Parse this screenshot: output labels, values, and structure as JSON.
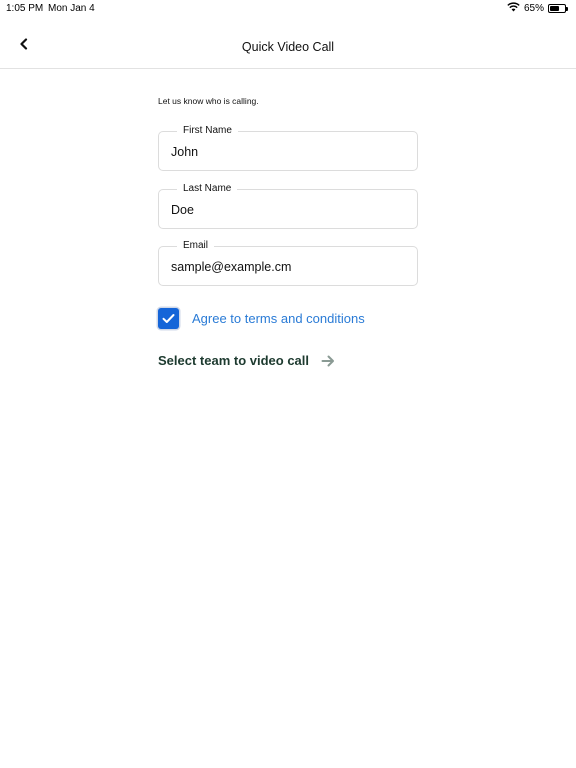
{
  "status_bar": {
    "time": "1:05 PM",
    "date": "Mon Jan 4",
    "battery_percent": "65%",
    "battery_level": 0.65
  },
  "nav": {
    "title": "Quick Video Call",
    "back_icon": "chevron-left-icon"
  },
  "form": {
    "intro": "Let us know who is calling.",
    "first_name": {
      "label": "First Name",
      "value": "John"
    },
    "last_name": {
      "label": "Last Name",
      "value": "Doe"
    },
    "email": {
      "label": "Email",
      "value": "sample@example.cm"
    },
    "terms": {
      "label": "Agree to terms and conditions",
      "checked": true
    },
    "cta": {
      "label": "Select team to video call",
      "icon": "arrow-right-icon"
    }
  },
  "colors": {
    "accent_blue": "#1565d8",
    "link_blue": "#2a7bd6",
    "cta_green": "#1d3a2f",
    "arrow_gray": "#8a9a94"
  }
}
